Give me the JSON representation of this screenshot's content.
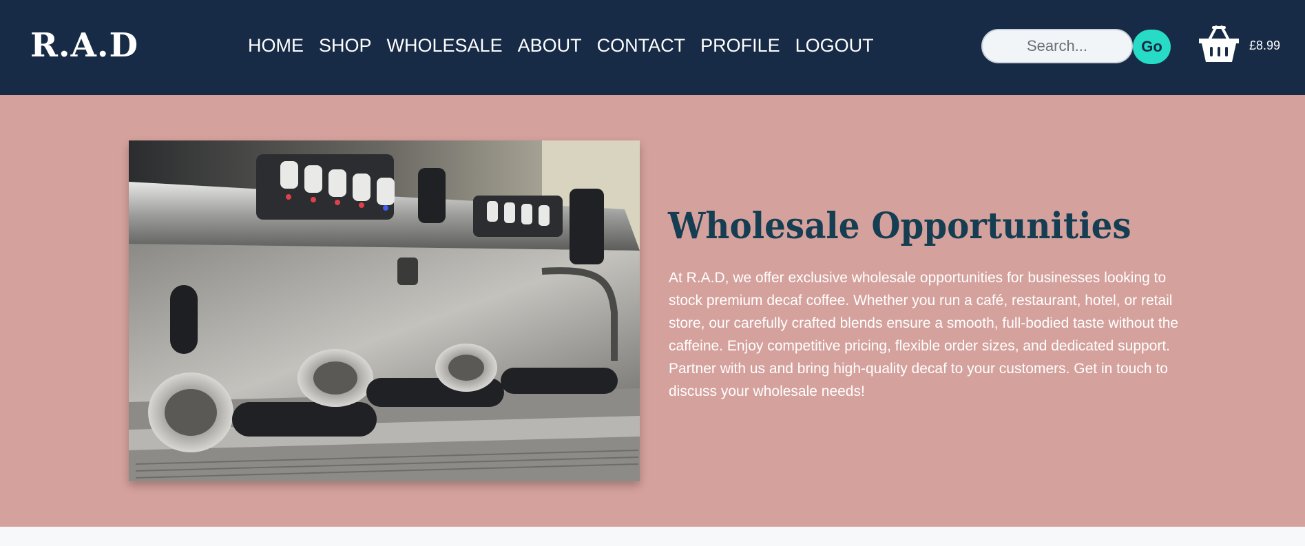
{
  "header": {
    "logo": "R.A.D",
    "nav": [
      "HOME",
      "SHOP",
      "WHOLESALE",
      "ABOUT",
      "CONTACT",
      "PROFILE",
      "LOGOUT"
    ],
    "search": {
      "placeholder": "Search...",
      "value": "",
      "button_label": "Go"
    },
    "cart": {
      "icon": "basket-icon",
      "total": "£8.99"
    }
  },
  "hero": {
    "image": "espresso-machine-photo",
    "title": "Wholesale Opportunities",
    "body": "At R.A.D, we offer exclusive wholesale opportunities for businesses looking to stock premium decaf coffee. Whether you run a café, restaurant, hotel, or retail store, our carefully crafted blends ensure a smooth, full-bodied taste without the caffeine. Enjoy competitive pricing, flexible order sizes, and dedicated support. Partner with us and bring high-quality decaf to your customers. Get in touch to discuss your wholesale needs!"
  },
  "colors": {
    "header_bg": "#172b46",
    "hero_bg": "#d5a19c",
    "accent": "#27dbc6",
    "title": "#163e52",
    "page_bg": "#f6f8fa"
  }
}
